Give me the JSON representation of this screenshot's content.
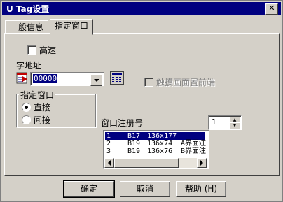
{
  "window": {
    "title": "U Tag设置",
    "close_glyph": "✕"
  },
  "tabs": [
    {
      "label": "一般信息"
    },
    {
      "label": "指定窗口"
    }
  ],
  "high_speed": {
    "label": "高速",
    "checked": false
  },
  "word_address": {
    "label": "字地址",
    "value": "00000"
  },
  "touch_front": {
    "label": "触摸画面置前端",
    "checked": false,
    "enabled": false
  },
  "window_group": {
    "title": "指定窗口",
    "options": [
      {
        "label": "直接",
        "selected": true
      },
      {
        "label": "间接",
        "selected": false
      }
    ]
  },
  "window_number": {
    "label": "窗口注册号",
    "value": "1"
  },
  "window_list": {
    "rows": [
      {
        "num": "1",
        "name": "B17",
        "size": "136x177",
        "extra": ""
      },
      {
        "num": "2",
        "name": "B19",
        "size": "136x74",
        "extra": "A界面注"
      },
      {
        "num": "3",
        "name": "B19",
        "size": "136x76",
        "extra": "B界面注"
      }
    ]
  },
  "buttons": {
    "ok": "确定",
    "cancel": "取消",
    "help": "帮助 (H)"
  },
  "colors": {
    "titlebar": "#000080",
    "face": "#d4d0c8",
    "selection": "#000080"
  },
  "icons": {
    "address_icon": "address-table-icon",
    "keypad_icon": "keypad-icon"
  }
}
